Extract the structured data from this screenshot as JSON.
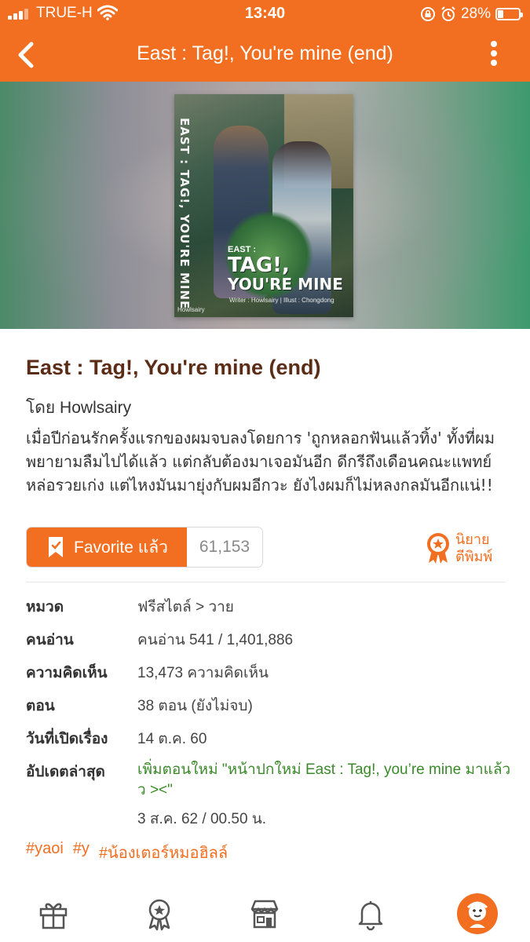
{
  "status_bar": {
    "carrier": "TRUE-H",
    "time": "13:40",
    "battery": "28%"
  },
  "header": {
    "title": "East : Tag!, You're mine (end)"
  },
  "cover": {
    "vertical_title": "EAST : TAG!, YOU'RE MINE",
    "line1": "EAST :",
    "line2": "TAG!,",
    "line3": "YOU'RE MINE",
    "credit": "Writer : Howlsairy | Illust : Chongdong",
    "author": "Howlsairy"
  },
  "story": {
    "title": "East : Tag!, You're mine (end)",
    "byline": "โดย Howlsairy",
    "synopsis": "เมื่อปีก่อนรักครั้งแรกของผมจบลงโดยการ 'ถูกหลอกฟันแล้วทิ้ง' ทั้งที่ผมพยายามลืมไปได้แล้ว แต่กลับต้องมาเจอมันอีก ดีกรีถึงเดือนคณะแพทย์ หล่อรวยเก่ง แต่ไหงมันมายุ่งกับผมอีกวะ ยังไงผมก็ไม่หลงกลมันอีกแน่!!"
  },
  "favorite": {
    "label": "Favorite แล้ว",
    "count": "61,153"
  },
  "badge": {
    "line1": "นิยาย",
    "line2": "ตีพิมพ์"
  },
  "info": {
    "category_label": "หมวด",
    "category_value": "ฟรีสไตล์ > วาย",
    "readers_label": "คนอ่าน",
    "readers_value": "คนอ่าน 541 / 1,401,886",
    "comments_label": "ความคิดเห็น",
    "comments_value": "13,473 ความคิดเห็น",
    "chapters_label": "ตอน",
    "chapters_value": "38 ตอน (ยังไม่จบ)",
    "opened_label": "วันที่เปิดเรื่อง",
    "opened_value": "14 ต.ค. 60",
    "updated_label": "อัปเดตล่าสุด",
    "updated_value": "เพิ่มตอนใหม่ \"หน้าปกใหม่ East : Tag!, you’re mine มาแล้วว ><\"",
    "updated_date": "3 ส.ค. 62 / 00.50 น."
  },
  "tags": [
    "#yaoi",
    "#y",
    "#น้องเตอร์หมอฮิลล์"
  ],
  "tabbar": {
    "icons": [
      "gift-icon",
      "award-icon",
      "store-icon",
      "bell-icon",
      "profile-icon"
    ]
  },
  "colors": {
    "accent": "#f26f21",
    "title_brown": "#5b2d17",
    "update_green": "#3a8a2a"
  }
}
